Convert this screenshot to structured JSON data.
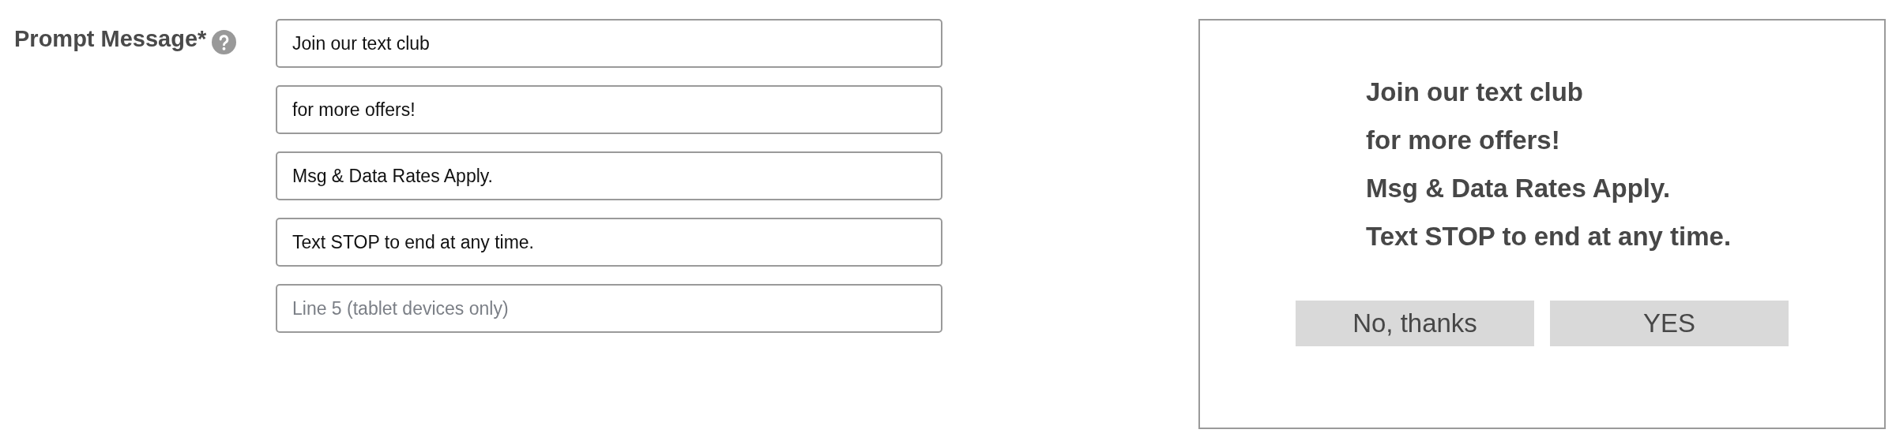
{
  "form": {
    "label": "Prompt Message*",
    "lines": [
      {
        "value": "Join our text club"
      },
      {
        "value": "for more offers!"
      },
      {
        "value": "Msg & Data Rates Apply."
      },
      {
        "value": "Text STOP to end at any time."
      },
      {
        "placeholder": "Line 5 (tablet devices only)"
      }
    ]
  },
  "preview": {
    "lines": [
      "Join our text club",
      "for more offers!",
      "Msg & Data Rates Apply.",
      "Text STOP to end at any time."
    ],
    "buttons": [
      "No, thanks",
      "YES"
    ]
  }
}
